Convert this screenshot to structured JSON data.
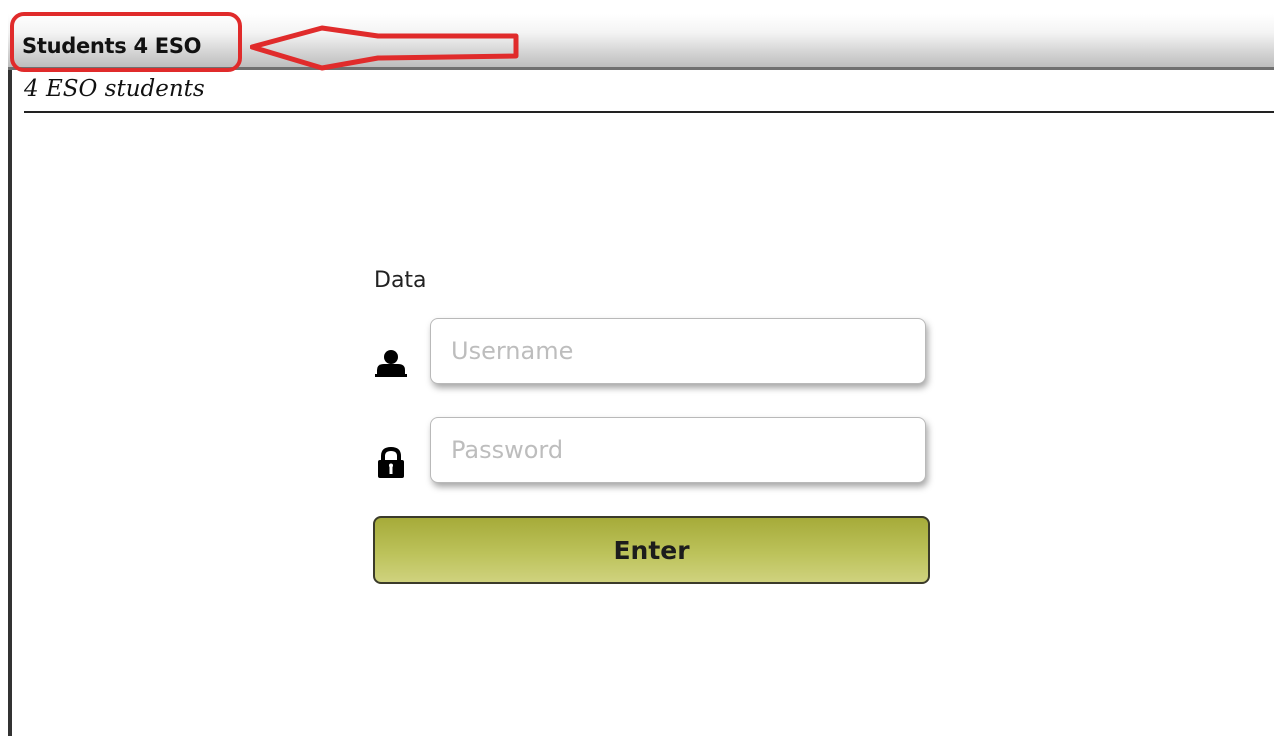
{
  "window": {
    "title": "Students 4 ESO"
  },
  "header": {
    "subtitle": "4 ESO students"
  },
  "login_form": {
    "legend": "Data",
    "username": {
      "icon": "user-icon",
      "placeholder": "Username",
      "value": ""
    },
    "password": {
      "icon": "lock-icon",
      "placeholder": "Password",
      "value": ""
    },
    "submit_label": "Enter"
  },
  "annotation": {
    "color": "#e02b2b",
    "icon": "arrow-left-icon"
  },
  "colors": {
    "button_top": "#a6ab3a",
    "button_bottom": "#cfd27e",
    "titlebar_border": "#6f6f6f"
  }
}
